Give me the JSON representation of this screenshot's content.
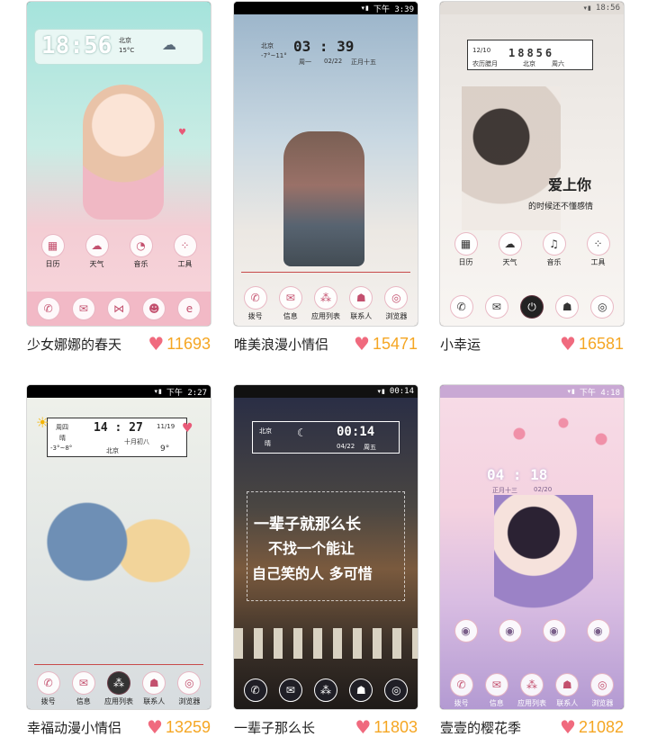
{
  "themes": [
    {
      "title": "少女娜娜的春天",
      "likes": "11693",
      "status_time": "",
      "clock": "18:56",
      "weather_city": "北京",
      "weather_temp": "15°C",
      "apps": [
        "日历",
        "天气",
        "音乐",
        "工具"
      ],
      "colors": {
        "top": "#9fe0da",
        "bottom": "#f6c7cf"
      }
    },
    {
      "title": "唯美浪漫小情侣",
      "likes": "15471",
      "status_time": "下午 3:39",
      "clock": "03 : 39",
      "date_a": "周一",
      "date_b": "02/22",
      "date_c": "正月十五",
      "weather_city": "北京",
      "weather_temp": "-7°~11°",
      "apps": [
        "拨号",
        "信息",
        "应用列表",
        "联系人",
        "浏览器"
      ],
      "colors": {
        "top": "#a9c3d6",
        "bottom": "#f1ece8"
      }
    },
    {
      "title": "小幸运",
      "likes": "16581",
      "status_time": "18:56",
      "clock": "18856",
      "date_a": "12/10",
      "date_b": "农历腊月",
      "date_c": "周六",
      "weather_city": "北京",
      "quote_a": "爱上你",
      "quote_b": "的时候还不懂感情",
      "apps": [
        "日历",
        "天气",
        "音乐",
        "工具"
      ],
      "colors": {
        "top": "#eeeae6",
        "bottom": "#f7f2ee"
      }
    },
    {
      "title": "幸福动漫小情侣",
      "likes": "13259",
      "status_time": "下午 2:27",
      "clock": "14 : 27",
      "date_a": "周四",
      "date_b": "11/19",
      "date_c": "十月初八",
      "weather_city": "北京",
      "weather_cond": "晴",
      "weather_range": "-3°~8°",
      "weather_temp": "9°",
      "apps": [
        "拨号",
        "信息",
        "应用列表",
        "联系人",
        "浏览器"
      ],
      "colors": {
        "top": "#e9ece6",
        "bottom": "#d8dde0"
      }
    },
    {
      "title": "一辈子那么长",
      "likes": "11803",
      "status_time": "00:14",
      "clock": "00:14",
      "date_a": "04/22",
      "date_b": "周五",
      "weather_city": "北京",
      "weather_cond": "晴",
      "quote_a": "一辈子就那么长",
      "quote_b": "不找一个能让",
      "quote_c": "自己笑的人 多可惜",
      "colors": {
        "top": "#2b2f45",
        "bottom": "#3a2f28"
      }
    },
    {
      "title": "壹壹的樱花季",
      "likes": "21082",
      "status_time": "下午 4:18",
      "clock": "04 : 18",
      "date_a": "正月十三",
      "date_b": "02/20",
      "apps_row1": [
        "",
        "",
        "",
        ""
      ],
      "apps": [
        "拨号",
        "信息",
        "应用列表",
        "联系人",
        "浏览器"
      ],
      "colors": {
        "top": "#f6d4e2",
        "bottom": "#b9a3d6"
      }
    }
  ]
}
